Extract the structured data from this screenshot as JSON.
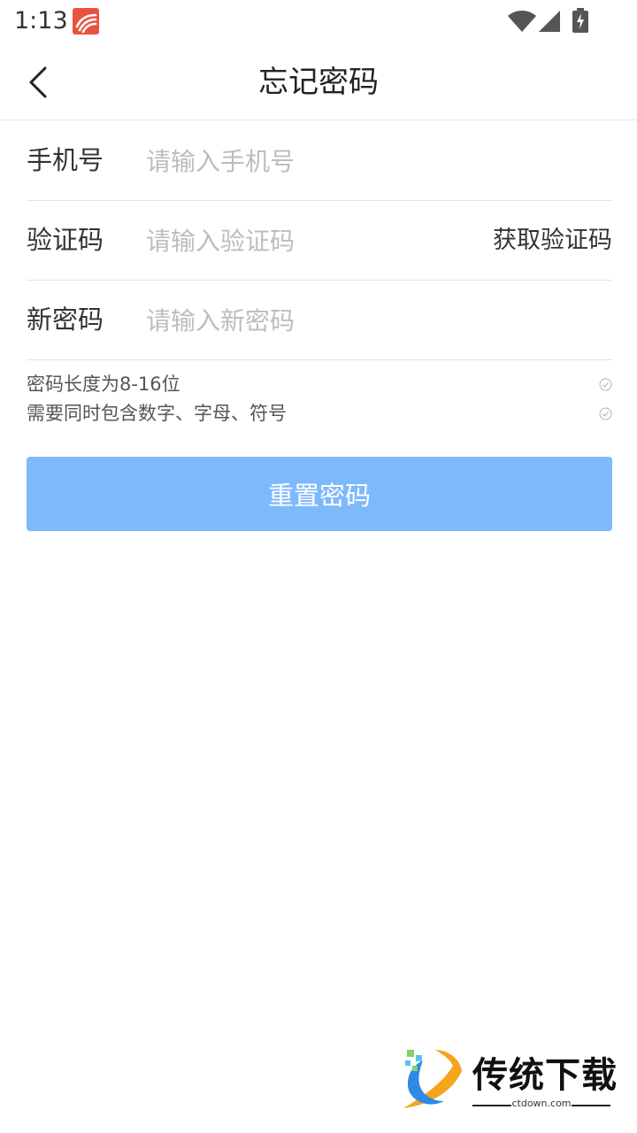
{
  "status_bar": {
    "time": "1:13",
    "app_icon": "flag-app-icon",
    "app_icon_color": "#e8533f",
    "icons": [
      "wifi-icon",
      "signal-icon",
      "battery-charging-icon"
    ]
  },
  "header": {
    "title": "忘记密码",
    "back_icon": "chevron-left-icon"
  },
  "form": {
    "phone": {
      "label": "手机号",
      "placeholder": "请输入手机号",
      "value": ""
    },
    "code": {
      "label": "验证码",
      "placeholder": "请输入验证码",
      "value": "",
      "get_code_label": "获取验证码"
    },
    "password": {
      "label": "新密码",
      "placeholder": "请输入新密码",
      "value": ""
    }
  },
  "rules": [
    {
      "text": "密码长度为8-16位",
      "icon": "check-circle-icon"
    },
    {
      "text": "需要同时包含数字、字母、符号",
      "icon": "check-circle-icon"
    }
  ],
  "submit": {
    "label": "重置密码",
    "color": "#7eb9fb"
  },
  "watermark": {
    "brand": "传统下载",
    "url": "ctdown.com"
  },
  "colors": {
    "placeholder": "#bcbcc3",
    "divider": "#e3e3e3"
  }
}
